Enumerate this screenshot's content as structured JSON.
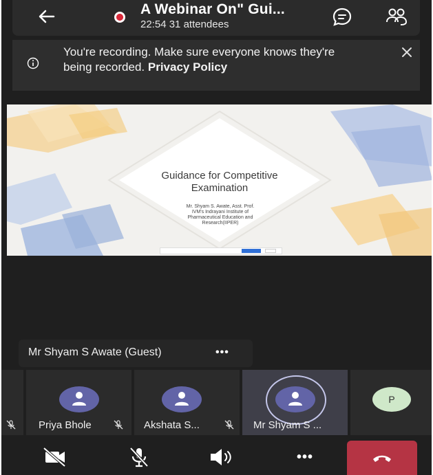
{
  "header": {
    "title": "A Webinar On\" Gui...",
    "elapsed": "22:54",
    "attendees": "31 attendees"
  },
  "banner": {
    "message": "You're recording. Make sure everyone knows they're being recorded.",
    "link": "Privacy Policy"
  },
  "slide": {
    "title_line1": "Guidance for Competitive",
    "title_line2": "Examination",
    "presenter_line1": "Mr. Shyam S. Awate, Asst. Prof.",
    "presenter_line2": "IVM's Indrayani Institute of",
    "presenter_line3": "Pharmaceutical Education and",
    "presenter_line4": "Research(IIPER)"
  },
  "presenter": {
    "name": "Mr Shyam S Awate (Guest)",
    "more": "•••"
  },
  "participants": [
    {
      "name": "Priya Bhole",
      "muted": true
    },
    {
      "name": "Akshata S...",
      "muted": true
    },
    {
      "name": "Mr Shyam S ...",
      "active": true
    },
    {
      "initial": "P"
    }
  ],
  "controls": {
    "more_label": "•••"
  },
  "colors": {
    "background": "#1f1f1f",
    "avatar": "#6264a7",
    "recording": "#d9293a",
    "hangup": "#b53444"
  }
}
